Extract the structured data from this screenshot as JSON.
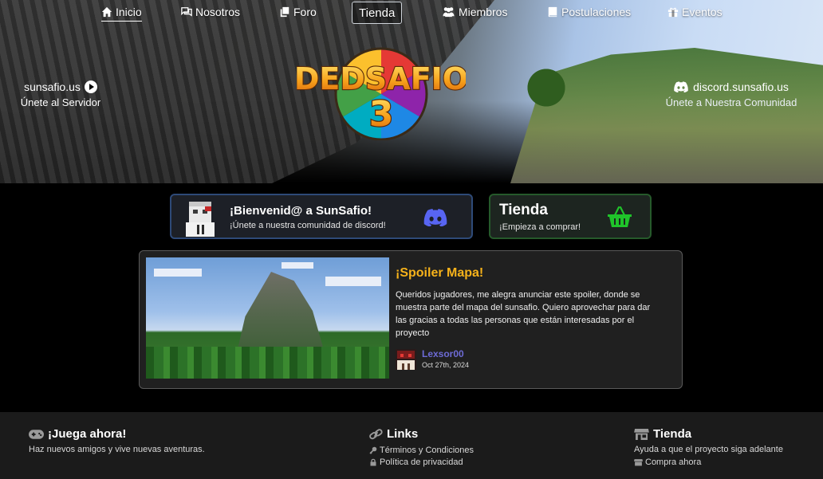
{
  "nav": {
    "items": [
      {
        "label": "Inicio",
        "icon": "home-icon"
      },
      {
        "label": "Nosotros",
        "icon": "chat-icon"
      },
      {
        "label": "Foro",
        "icon": "copy-icon"
      },
      {
        "label": "Tienda",
        "icon": ""
      },
      {
        "label": "Miembros",
        "icon": "users-icon"
      },
      {
        "label": "Postulaciones",
        "icon": "book-icon"
      },
      {
        "label": "Eventos",
        "icon": "gift-icon"
      }
    ]
  },
  "hero": {
    "logo_text_top": "DEDSAFIO",
    "logo_text_num": "3",
    "server": {
      "host": "sunsafio.us",
      "cta": "Únete al Servidor"
    },
    "discord": {
      "host": "discord.sunsafio.us",
      "cta": "Únete a Nuestra Comunidad"
    }
  },
  "cards": {
    "discord": {
      "title": "¡Bienvenid@ a SunSafio!",
      "subtitle": "¡Únete a nuestra comunidad de discord!",
      "color": "#5865F2"
    },
    "shop": {
      "title": "Tienda",
      "subtitle": "¡Empieza a comprar!",
      "color": "#1fc42a"
    }
  },
  "news": {
    "title": "¡Spoiler Mapa!",
    "body": "Queridos jugadores, me alegra anunciar este spoiler, donde se muestra parte del mapa del sunsafio. Quiero aprovechar para dar las gracias a todas las personas que están interesadas por el proyecto",
    "author": "Lexsor00",
    "date": "Oct 27th, 2024",
    "title_color": "#f6b21a",
    "author_color": "#6d6bd6"
  },
  "footer": {
    "play": {
      "title": "¡Juega ahora!",
      "text": "Haz nuevos amigos y vive nuevas aventuras."
    },
    "links": {
      "title": "Links",
      "items": [
        "Términos y Condiciones",
        "Política de privacidad"
      ]
    },
    "shop": {
      "title": "Tienda",
      "text": "Ayuda a que el proyecto siga adelante",
      "link": "Compra ahora"
    }
  }
}
